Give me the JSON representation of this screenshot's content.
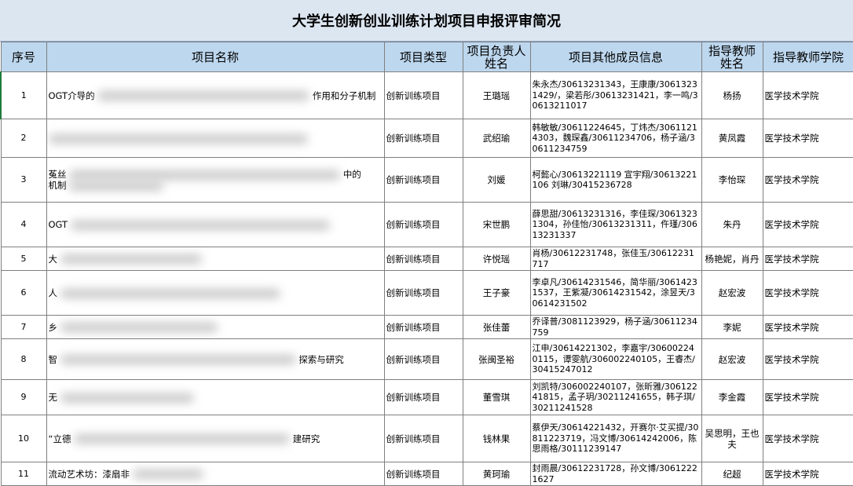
{
  "title": "大学生创新创业训练计划项目申报评审简况",
  "headers": {
    "index": "序号",
    "name": "项目名称",
    "type": "项目类型",
    "leader": "项目负责人姓名",
    "members": "项目其他成员信息",
    "advisor": "指导教师姓名",
    "college": "指导教师学院"
  },
  "rows": [
    {
      "index": "1",
      "name_pre": "OGT介导的",
      "name_post": "作用和分子机制",
      "type": "创新训练项目",
      "leader": "王璐瑶",
      "members": "朱永杰/30613231343，王康康/30613231429/，梁若彤/30613231421，李一鸣/30613211017",
      "advisor": "杨扬",
      "college": "医学技术学院"
    },
    {
      "index": "2",
      "name_pre": "",
      "name_post": "",
      "type": "创新训练项目",
      "leader": "武绍瑜",
      "members": "韩敏敏/30611224645，丁炜杰/30611214303，魏琛鑫/30611234706，杨子涵/30611234759",
      "advisor": "黄凤霞",
      "college": "医学技术学院"
    },
    {
      "index": "3",
      "name_pre": "菟丝",
      "name_post": "中的",
      "name_line2": "机制",
      "type": "创新训练项目",
      "leader": "刘媛",
      "members": "柯懿心/30613221119 宣宇翔/30613221106 刘琳/30415236728",
      "advisor": "李怡琛",
      "college": "医学技术学院"
    },
    {
      "index": "4",
      "name_pre": "OGT",
      "name_post": "",
      "type": "创新训练项目",
      "leader": "宋世鹏",
      "members": "薛思甜/30613231316，李佳琛/30613231304，孙佳怡/30613231311，仵瑾/30613231337",
      "advisor": "朱丹",
      "college": "医学技术学院"
    },
    {
      "index": "5",
      "name_pre": "大",
      "name_post": "",
      "type": "创新训练项目",
      "leader": "许悦瑶",
      "members": "肖杨/30612231748，张佳玉/30612231717",
      "advisor": "杨艳妮，肖丹",
      "college": "医学技术学院"
    },
    {
      "index": "6",
      "name_pre": "人",
      "name_post": "",
      "type": "创新训练项目",
      "leader": "王子豪",
      "members": "李卓凡/30614231546，简华丽/30614231537，王紫凝/30614231542，涂昱天/30614231502",
      "advisor": "赵宏波",
      "college": "医学技术学院"
    },
    {
      "index": "7",
      "name_pre": "乡",
      "name_post": "",
      "type": "创新训练项目",
      "leader": "张佳蕾",
      "members": "乔译普/3081123929，杨子涵/30611234759",
      "advisor": "李妮",
      "college": "医学技术学院"
    },
    {
      "index": "8",
      "name_pre": "智",
      "name_post": "探索与研究",
      "type": "创新训练项目",
      "leader": "张闽圣裕",
      "members": "江申/30614221302，李嘉宇/306002240115，谭雯航/306002240105，王睿杰/30415247012",
      "advisor": "赵宏波",
      "college": "医学技术学院"
    },
    {
      "index": "9",
      "name_pre": "无",
      "name_post": "",
      "type": "创新训练项目",
      "leader": "董雪琪",
      "members": "刘凯特/306002240107，张昕雅/30612241815，孟子玥/30211241655，韩子琪/30211241528",
      "advisor": "李金霞",
      "college": "医学技术学院"
    },
    {
      "index": "10",
      "name_pre": "“立德",
      "name_post": "建研究",
      "type": "创新训练项目",
      "leader": "钱林果",
      "members": "蔡伊天/30614221432，开赛尔·艾买提/30811223719，冯文博/30614242006，陈思雨格/30111239147",
      "advisor": "吴思明，王也夫",
      "college": "医学技术学院"
    },
    {
      "index": "11",
      "name_pre": "流动艺术坊：漆扇非",
      "name_post": "",
      "type": "创新训练项目",
      "leader": "黄珂瑜",
      "members": "封雨晨/30612231728，孙文博/30612221627",
      "advisor": "纪超",
      "college": "医学技术学院"
    }
  ]
}
